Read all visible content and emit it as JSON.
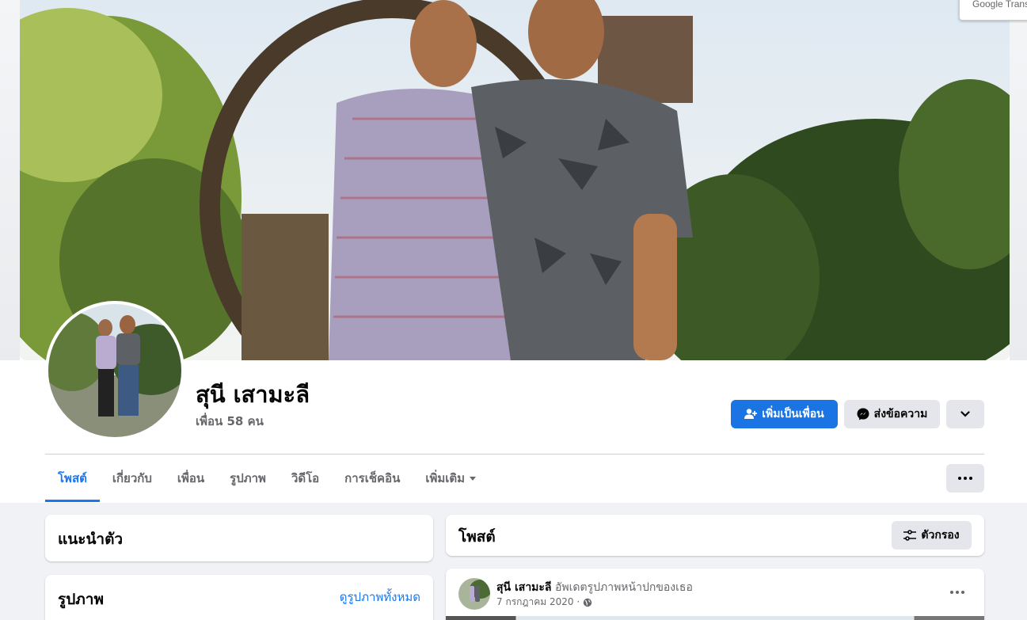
{
  "translate_badge": "Google Translate",
  "profile": {
    "name": "สุนี เสามะลี",
    "friend_count": "เพื่อน 58 คน"
  },
  "actions": {
    "add_friend": "เพิ่มเป็นเพื่อน",
    "message": "ส่งข้อความ"
  },
  "tabs": [
    {
      "label": "โพสต์"
    },
    {
      "label": "เกี่ยวกับ"
    },
    {
      "label": "เพื่อน"
    },
    {
      "label": "รูปภาพ"
    },
    {
      "label": "วิดีโอ"
    },
    {
      "label": "การเช็คอิน"
    },
    {
      "label": "เพิ่มเติม"
    }
  ],
  "left_column": {
    "intro_title": "แนะนำตัว",
    "photos_title": "รูปภาพ",
    "see_all_photos": "ดูรูปภาพทั้งหมด"
  },
  "posts": {
    "title": "โพสต์",
    "filter_label": "ตัวกรอง",
    "first_post": {
      "author": "สุนี เสามะลี",
      "activity": "อัพเดตรูปภาพหน้าปกของเธอ",
      "date": "7 กรกฎาคม 2020 ·"
    }
  },
  "colors": {
    "accent": "#1877f2",
    "button_primary": "#1b74e4",
    "secondary_button": "#e4e6eb",
    "page_bg": "#f0f2f5"
  }
}
